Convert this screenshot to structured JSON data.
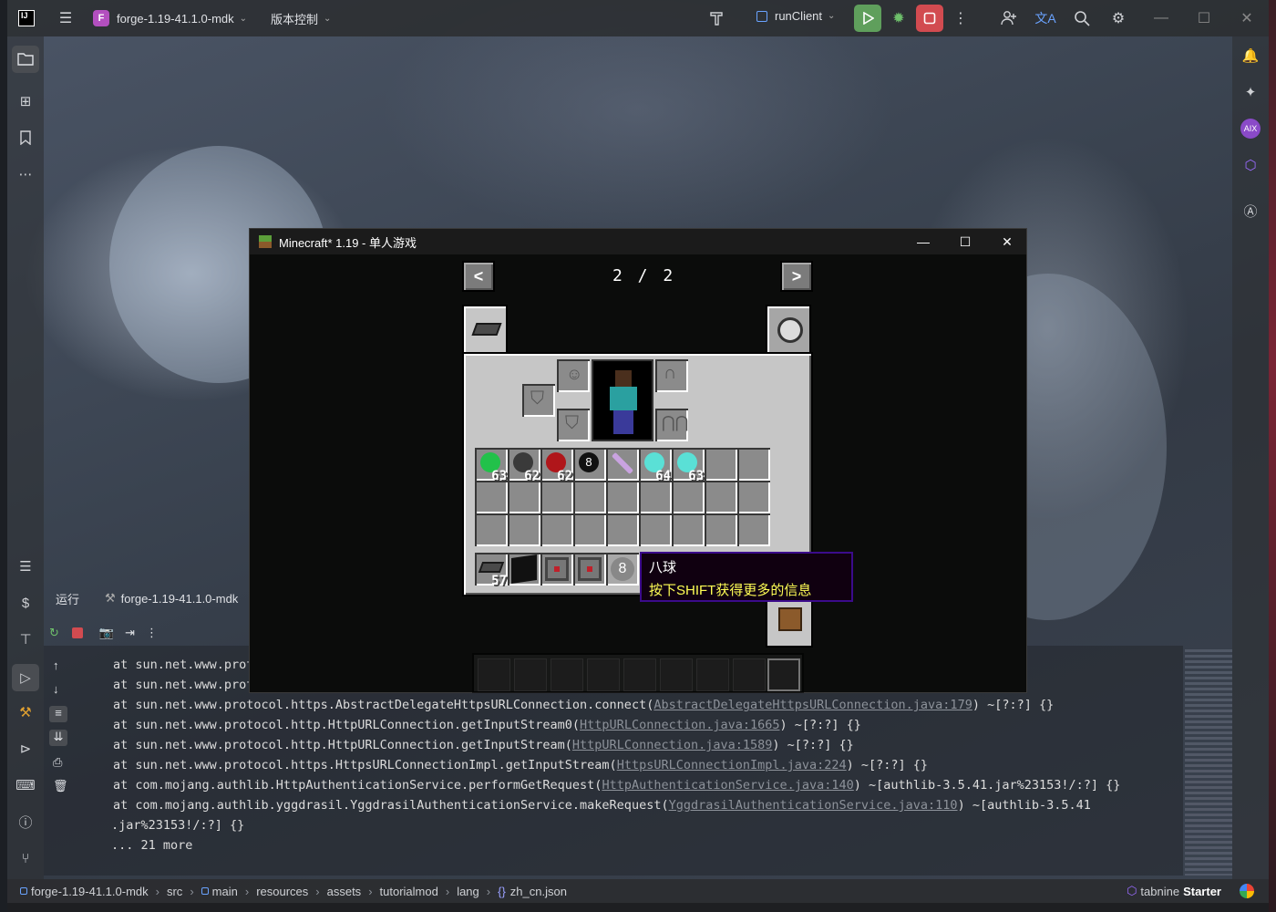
{
  "topbar": {
    "project_badge": "F",
    "project_name": "forge-1.19-41.1.0-mdk",
    "vcs_label": "版本控制",
    "run_config": "runClient"
  },
  "run_panel": {
    "tab_label": "运行",
    "config_name": "forge-1.19-41.1.0-mdk"
  },
  "console": {
    "lines": [
      {
        "text": "at sun.net.www.prot",
        "link": "",
        "suffix": ""
      },
      {
        "text": "at sun.net.www.prot",
        "link": "",
        "suffix": ""
      },
      {
        "text": "at sun.net.www.protocol.https.AbstractDelegateHttpsURLConnection.connect(",
        "link": "AbstractDelegateHttpsURLConnection.java:179",
        "suffix": ") ~[?:?] {}"
      },
      {
        "text": "at sun.net.www.protocol.http.HttpURLConnection.getInputStream0(",
        "link": "HttpURLConnection.java:1665",
        "suffix": ") ~[?:?] {}"
      },
      {
        "text": "at sun.net.www.protocol.http.HttpURLConnection.getInputStream(",
        "link": "HttpURLConnection.java:1589",
        "suffix": ") ~[?:?] {}"
      },
      {
        "text": "at sun.net.www.protocol.https.HttpsURLConnectionImpl.getInputStream(",
        "link": "HttpsURLConnectionImpl.java:224",
        "suffix": ") ~[?:?] {}"
      },
      {
        "text": "at com.mojang.authlib.HttpAuthenticationService.performGetRequest(",
        "link": "HttpAuthenticationService.java:140",
        "suffix": ") ~[authlib-3.5.41.jar%23153!/:?] {}"
      },
      {
        "text": "at com.mojang.authlib.yggdrasil.YggdrasilAuthenticationService.makeRequest(",
        "link": "YggdrasilAuthenticationService.java:110",
        "suffix": ") ~[authlib-3.5.41"
      },
      {
        "text": " .jar%23153!/:?] {}",
        "link": "",
        "suffix": ""
      },
      {
        "text": "... 21 more",
        "link": "",
        "suffix": ""
      }
    ]
  },
  "breadcrumb": [
    "forge-1.19-41.1.0-mdk",
    "src",
    "main",
    "resources",
    "assets",
    "tutorialmod",
    "lang",
    "zh_cn.json"
  ],
  "status_right": {
    "tabnine": "tabnine",
    "tabnine_plan": "Starter"
  },
  "minecraft": {
    "window_title": "Minecraft* 1.19 - 单人游戏",
    "page_indicator": "2 / 2",
    "slots_row1": [
      {
        "item": "emerald",
        "count": "63",
        "color": "#22c14a"
      },
      {
        "item": "coal",
        "count": "62",
        "color": "#3a3a3a"
      },
      {
        "item": "redstone",
        "count": "62",
        "color": "#b0161a"
      },
      {
        "item": "eight-ball",
        "count": "",
        "color": "#111111"
      },
      {
        "item": "sword",
        "count": "",
        "color": "#c9a3e0"
      },
      {
        "item": "diamond",
        "count": "64",
        "color": "#5ae0d6"
      },
      {
        "item": "diamond",
        "count": "63",
        "color": "#5ae0d6"
      }
    ],
    "hotbar_first_count": "57",
    "tooltip_title": "八球",
    "tooltip_hint": "按下SHIFT获得更多的信息",
    "eight_label": "8"
  },
  "colors": {
    "run_green": "#5f9f5c",
    "stop_red": "#d24b50",
    "tooltip_border": "#3b0b8b",
    "tooltip_hint": "#ffff55"
  }
}
